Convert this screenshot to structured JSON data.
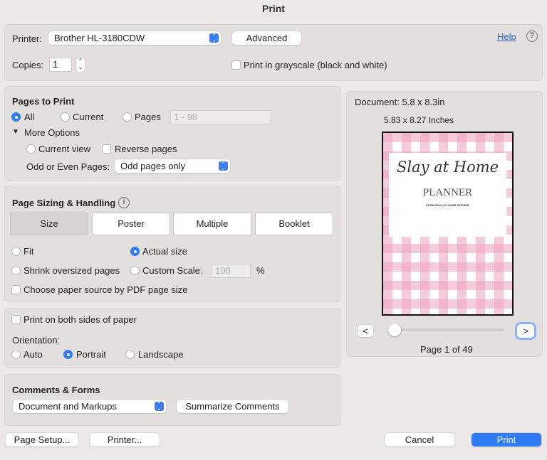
{
  "window": {
    "title": "Print"
  },
  "printer": {
    "label": "Printer:",
    "value": "Brother HL-3180CDW",
    "advanced": "Advanced",
    "help": "Help",
    "help_icon": "?"
  },
  "copies": {
    "label": "Copies:",
    "value": "1",
    "grayscale": "Print in grayscale (black and white)"
  },
  "pages": {
    "heading": "Pages to Print",
    "all": "All",
    "current": "Current",
    "pages": "Pages",
    "range_placeholder": "1 - 98",
    "more_options": "More Options",
    "current_view": "Current view",
    "reverse": "Reverse pages",
    "odd_even_label": "Odd or Even Pages:",
    "odd_even_value": "Odd pages only"
  },
  "sizing": {
    "heading": "Page Sizing & Handling",
    "tabs": [
      "Size",
      "Poster",
      "Multiple",
      "Booklet"
    ],
    "fit": "Fit",
    "actual": "Actual size",
    "shrink": "Shrink oversized pages",
    "custom": "Custom Scale:",
    "scale_value": "100",
    "percent": "%",
    "paper_source": "Choose paper source by PDF page size"
  },
  "duplex": {
    "both_sides": "Print on both sides of paper",
    "orientation_label": "Orientation:",
    "auto": "Auto",
    "portrait": "Portrait",
    "landscape": "Landscape"
  },
  "comments": {
    "heading": "Comments & Forms",
    "value": "Document and Markups",
    "summarize": "Summarize Comments"
  },
  "preview": {
    "document": "Document: 5.8 x 8.3in",
    "size": "5.83 x 8.27 Inches",
    "page_title": "Slay at Home",
    "page_subtitle": "PLANNER",
    "page_tagline": "FROM SLAY AT HOME MOTHER",
    "prev": "<",
    "next": ">",
    "page_indicator": "Page 1 of 49",
    "slider_position": 0,
    "gingham_color": "#f0b8cc"
  },
  "footer": {
    "page_setup": "Page Setup...",
    "printer": "Printer...",
    "cancel": "Cancel",
    "print": "Print"
  }
}
